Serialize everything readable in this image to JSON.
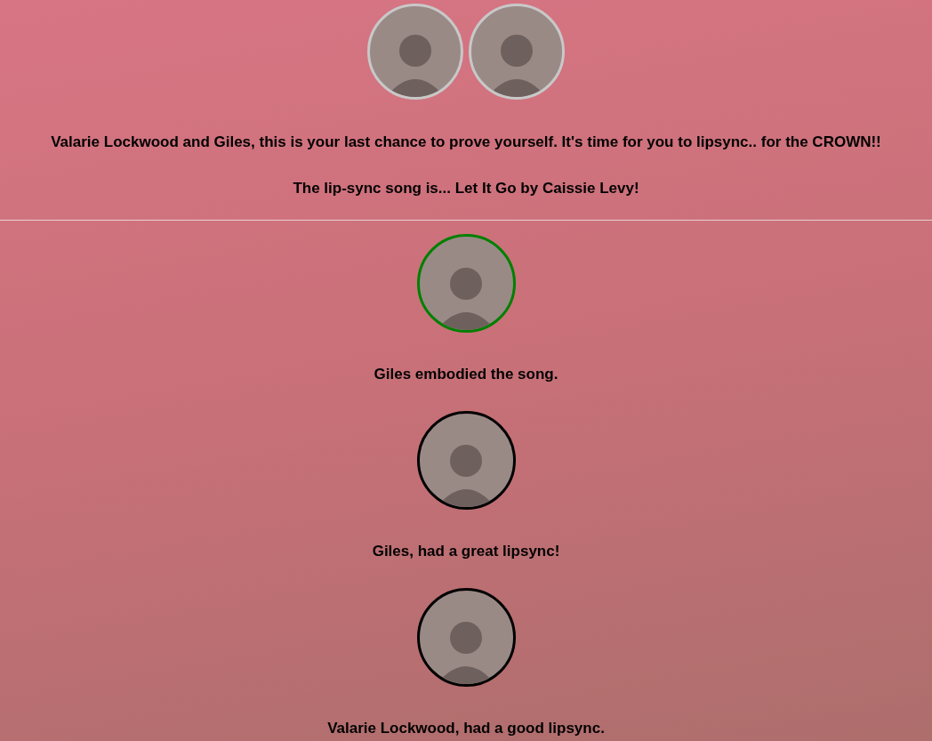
{
  "header": {
    "avatars": [
      {
        "kind": "photo"
      },
      {
        "kind": "photo"
      }
    ],
    "announcement": "Valarie Lockwood and Giles, this is your last chance to prove yourself. It's time for you to lipsync.. for the CROWN!!",
    "song": "The lip-sync song is... Let It Go by Caissie Levy!"
  },
  "results": [
    {
      "color": "#008000",
      "text": "Giles embodied the song."
    },
    {
      "color": "#000000",
      "text": "Giles, had a great lipsync!"
    },
    {
      "color": "#000000",
      "text": "Valarie Lockwood, had a good lipsync."
    }
  ]
}
